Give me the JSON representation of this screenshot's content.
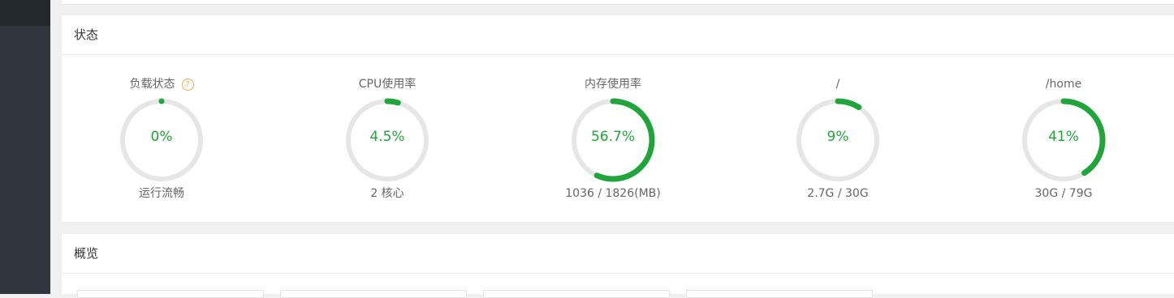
{
  "status_panel": {
    "title": "状态",
    "gauges": [
      {
        "title": "负载状态",
        "value_text": "0%",
        "percent": 0,
        "subtitle": "运行流畅",
        "has_help": true
      },
      {
        "title": "CPU使用率",
        "value_text": "4.5%",
        "percent": 4.5,
        "subtitle": "2 核心",
        "has_help": false
      },
      {
        "title": "内存使用率",
        "value_text": "56.7%",
        "percent": 56.7,
        "subtitle": "1036 / 1826(MB)",
        "has_help": false
      },
      {
        "title": "/",
        "value_text": "9%",
        "percent": 9,
        "subtitle": "2.7G / 30G",
        "has_help": false
      },
      {
        "title": "/home",
        "value_text": "41%",
        "percent": 41,
        "subtitle": "30G / 79G",
        "has_help": false
      }
    ]
  },
  "help_icon_text": "?",
  "overview_panel": {
    "title": "概览"
  },
  "colors": {
    "accent": "#20a53a",
    "ring_track": "#e6e6e6",
    "help": "#f0ad4e",
    "sidebar": "#30363d"
  }
}
